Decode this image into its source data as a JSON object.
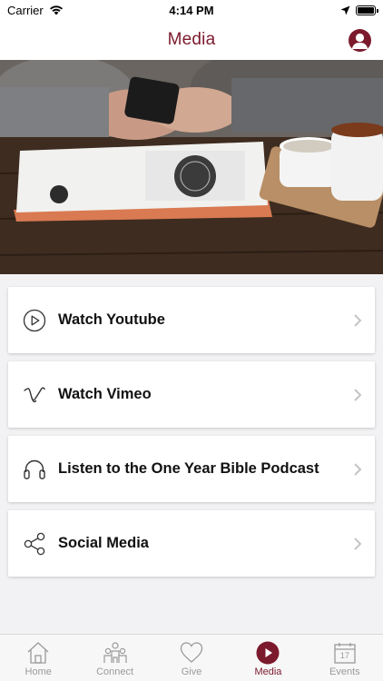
{
  "status_bar": {
    "carrier": "Carrier",
    "time": "4:14 PM"
  },
  "header": {
    "title": "Media",
    "profile_icon": "user-profile-icon"
  },
  "menu": {
    "items": [
      {
        "label": "Watch Youtube",
        "icon": "play-circle-icon"
      },
      {
        "label": "Watch Vimeo",
        "icon": "vimeo-icon"
      },
      {
        "label": "Listen to the One Year Bible Podcast",
        "icon": "headphones-icon"
      },
      {
        "label": "Social Media",
        "icon": "share-icon"
      }
    ]
  },
  "tab_bar": {
    "tabs": [
      {
        "label": "Home",
        "icon": "home-icon",
        "active": false
      },
      {
        "label": "Connect",
        "icon": "people-icon",
        "active": false
      },
      {
        "label": "Give",
        "icon": "heart-icon",
        "active": false
      },
      {
        "label": "Media",
        "icon": "play-circle-icon",
        "active": true
      },
      {
        "label": "Events",
        "icon": "calendar-icon",
        "active": false,
        "calendar_day": "17"
      }
    ]
  },
  "colors": {
    "accent": "#7b1a2c",
    "inactive": "#9a9a9a",
    "background": "#f2f2f4"
  }
}
